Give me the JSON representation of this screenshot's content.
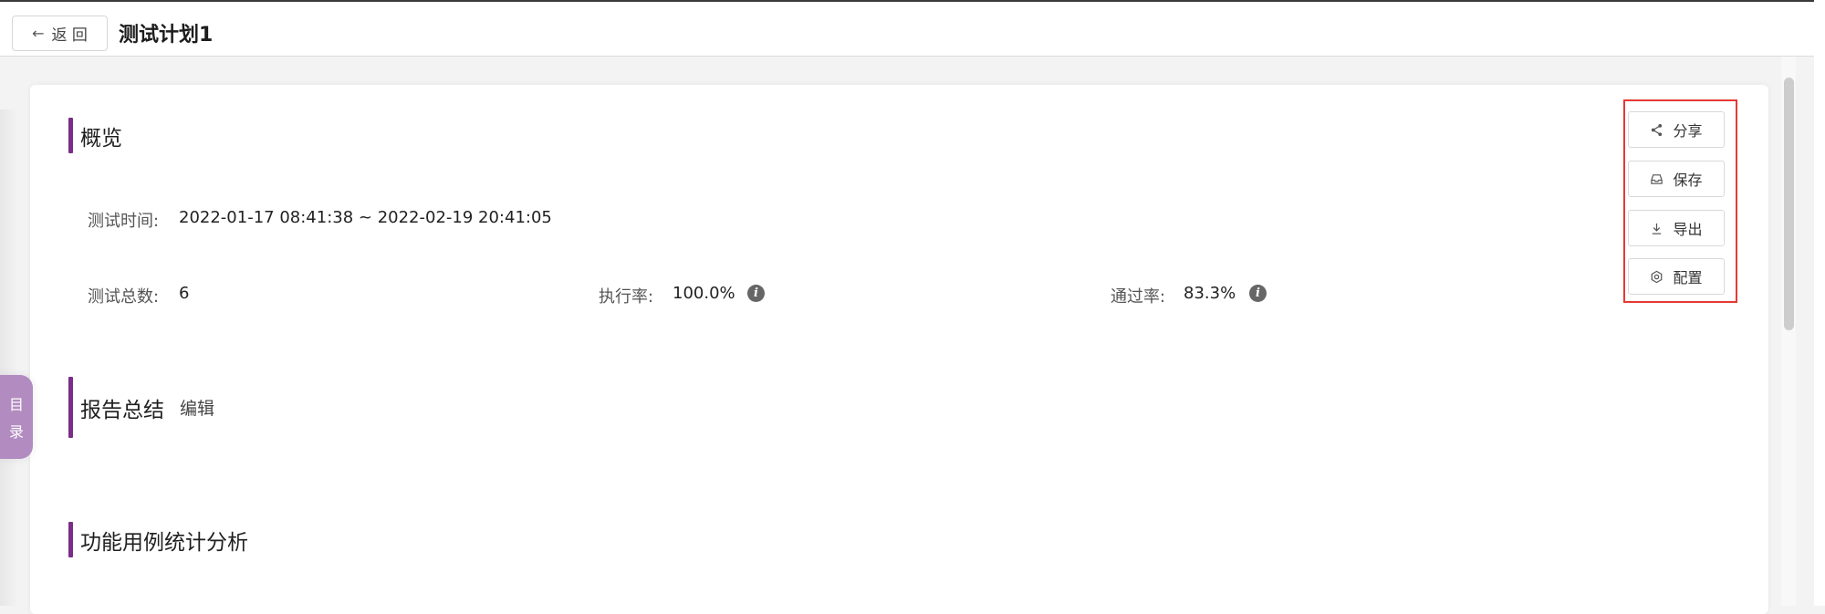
{
  "header": {
    "back_label": "返 回",
    "title": "测试计划1"
  },
  "overview": {
    "title": "概览",
    "test_time_label": "测试时间:",
    "test_time_value": "2022-01-17 08:41:38 ~ 2022-02-19 20:41:05",
    "total_label": "测试总数:",
    "total_value": "6",
    "exec_rate_label": "执行率:",
    "exec_rate_value": "100.0%",
    "pass_rate_label": "通过率:",
    "pass_rate_value": "83.3%"
  },
  "summary": {
    "title": "报告总结",
    "edit_label": "编辑"
  },
  "analysis": {
    "title": "功能用例统计分析"
  },
  "actions": {
    "share_label": "分享",
    "save_label": "保存",
    "export_label": "导出",
    "config_label": "配置"
  },
  "toc": {
    "char1": "目",
    "char2": "录"
  },
  "colors": {
    "accent": "#7a2e88",
    "highlight_border": "#e53935",
    "toc_bg": "#b28bc0"
  }
}
